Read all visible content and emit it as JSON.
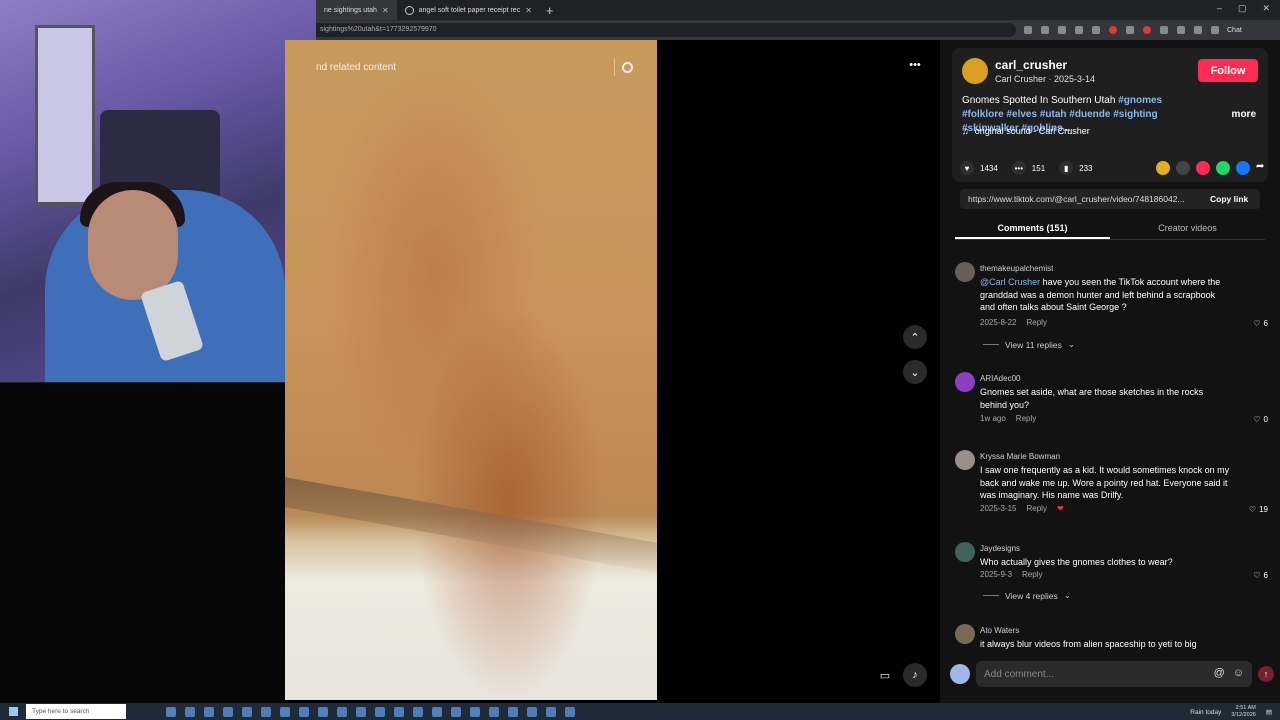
{
  "browser": {
    "tabs": [
      {
        "label": "ne sightings utah",
        "active": true
      },
      {
        "label": "angel soft toilet paper receipt rec",
        "active": false
      }
    ],
    "new_tab": "+",
    "window_controls": [
      "–",
      "▢",
      "✕"
    ],
    "url": "sightings%20utah&t=1773292579970",
    "chat_label": "Chat"
  },
  "video": {
    "search_text": "nd related content",
    "more_options": "•••",
    "prev": "⌃",
    "next": "⌄"
  },
  "post": {
    "username": "carl_crusher",
    "display_line": "Carl Crusher · 2025-3-14",
    "follow_label": "Follow",
    "title": "Gnomes Spotted In Southern Utah",
    "hashtags": [
      "#gnomes",
      "#folklore",
      "#elves",
      "#utah",
      "#duende",
      "#sighting",
      "#skinwalker",
      "#goblins..."
    ],
    "more_label": "more",
    "sound": "original sound - Carl Crusher",
    "likes": "1434",
    "comments": "151",
    "saves": "233",
    "link": "https://www.tiktok.com/@carl_crusher/video/748186042...",
    "copy_link": "Copy link",
    "share_colors": [
      "#e0b020",
      "#444444",
      "#fe2c55",
      "#25d366",
      "#1877f2"
    ]
  },
  "tabs": {
    "comments": "Comments (151)",
    "creator": "Creator videos"
  },
  "comments": [
    {
      "name": "themakeupalchemist",
      "mention": "@Carl Crusher",
      "text": " have you seen the TikTok account where the granddad was a demon hunter and left behind a scrapbook and often talks about Saint George ?",
      "date": "2025-8-22",
      "reply": "Reply",
      "likes": "6",
      "view_replies": "View 11 replies"
    },
    {
      "name": "ARIAdec00",
      "mention": "",
      "text": "Gnomes set aside, what are those sketches in the rocks behind you?",
      "date": "1w ago",
      "reply": "Reply",
      "likes": "0",
      "view_replies": ""
    },
    {
      "name": "Kryssa Marie Bowman",
      "mention": "",
      "text": "I saw one frequently as a kid. It would sometimes knock on my back and wake me up. Wore a pointy red hat. Everyone said it was imaginary. His name was Drilfy.",
      "date": "2025-3-15",
      "reply": "Reply",
      "likes": "19",
      "view_replies": ""
    },
    {
      "name": "Jaydesigns",
      "mention": "",
      "text": "Who actually gives the gnomes clothes to wear?",
      "date": "2025-9-3",
      "reply": "Reply",
      "likes": "6",
      "view_replies": "View 4 replies"
    },
    {
      "name": "Ato Waters",
      "mention": "",
      "text": "it always blur videos from alien spaceship to yeti to big",
      "date": "",
      "reply": "",
      "likes": "",
      "view_replies": ""
    }
  ],
  "composer": {
    "placeholder": "Add comment...",
    "at": "@",
    "emoji": "☺"
  },
  "taskbar": {
    "search_placeholder": "Type here to search",
    "weather": "Rain today",
    "time": "2:51 AM",
    "date": "3/12/2026"
  }
}
